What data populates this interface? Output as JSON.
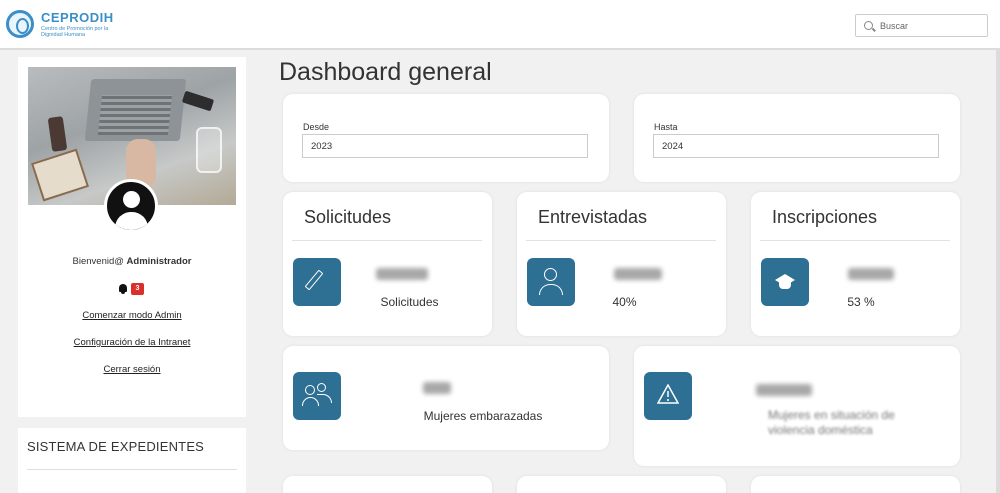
{
  "header": {
    "brand_name": "CEPRODIH",
    "brand_tagline": "Centro de Promoción por la Dignidad Humana",
    "search_placeholder": "Buscar"
  },
  "sidebar": {
    "welcome_prefix": "Bienvenid@",
    "user_name": "Administrador",
    "notification_count": "3",
    "links": [
      "Comenzar modo Admin",
      "Configuración de la Intranet",
      "Cerrar sesión"
    ],
    "section_title": "SISTEMA DE EXPEDIENTES"
  },
  "main": {
    "page_title": "Dashboard general",
    "filters": {
      "from_label": "Desde",
      "from_value": "2023",
      "to_label": "Hasta",
      "to_value": "2024"
    },
    "stats": [
      {
        "title": "Solicitudes",
        "subtitle": "Solicitudes",
        "icon": "pencil-icon"
      },
      {
        "title": "Entrevistadas",
        "subtitle": "40%",
        "icon": "person-icon"
      },
      {
        "title": "Inscripciones",
        "subtitle": "53 %",
        "icon": "graduation-cap-icon"
      }
    ],
    "wide_stats": [
      {
        "subtitle": "Mujeres embarazadas",
        "icon": "users-icon"
      },
      {
        "subtitle": "Mujeres en situación de violencia doméstica",
        "icon": "warning-icon"
      }
    ]
  },
  "colors": {
    "accent": "#2e6f94",
    "brand": "#3b8fc8",
    "badge": "#d9302b"
  }
}
